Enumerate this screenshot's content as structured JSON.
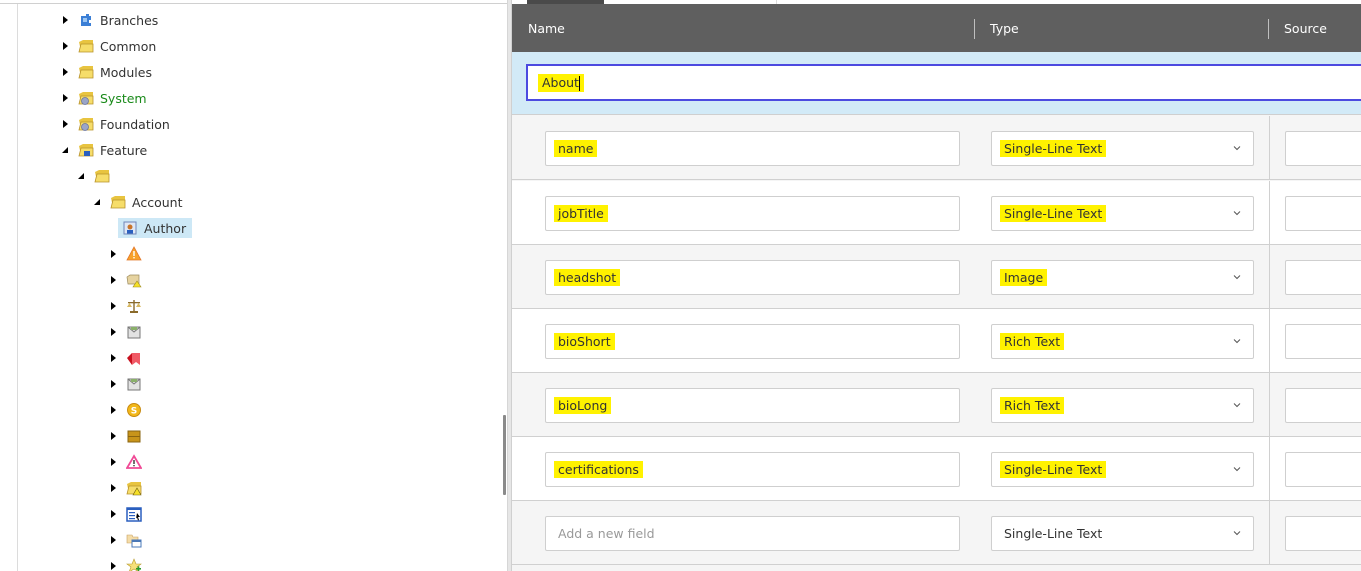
{
  "tree": {
    "nodes": [
      {
        "label": "Branches",
        "icon": "branches-icon",
        "expanded": false
      },
      {
        "label": "Common",
        "icon": "folder-icon",
        "expanded": false
      },
      {
        "label": "Modules",
        "icon": "folder-icon",
        "expanded": false
      },
      {
        "label": "System",
        "icon": "system-folder-icon",
        "expanded": false
      },
      {
        "label": "Foundation",
        "icon": "system-folder-icon",
        "expanded": false
      },
      {
        "label": "Feature",
        "icon": "feature-folder-icon",
        "expanded": true
      },
      {
        "label": "",
        "icon": "folder-icon",
        "expanded": true
      },
      {
        "label": "Account",
        "icon": "folder-icon",
        "expanded": true
      },
      {
        "label": "Author",
        "icon": "template-icon",
        "selected": true
      },
      {
        "label": "",
        "icon": "warning-icon",
        "expanded": false
      },
      {
        "label": "",
        "icon": "folder-warning-icon",
        "expanded": false
      },
      {
        "label": "",
        "icon": "scales-icon",
        "expanded": false
      },
      {
        "label": "",
        "icon": "envelope-icon",
        "expanded": false
      },
      {
        "label": "",
        "icon": "red-bookmark-icon",
        "expanded": false
      },
      {
        "label": "",
        "icon": "envelope-icon",
        "expanded": false
      },
      {
        "label": "",
        "icon": "coin-icon",
        "expanded": false
      },
      {
        "label": "",
        "icon": "drawer-icon",
        "expanded": false
      },
      {
        "label": "",
        "icon": "pink-warning-icon",
        "expanded": false
      },
      {
        "label": "",
        "icon": "folder-warning-icon",
        "expanded": false
      },
      {
        "label": "",
        "icon": "form-icon",
        "expanded": false
      },
      {
        "label": "",
        "icon": "folder-window-icon",
        "expanded": false
      },
      {
        "label": "",
        "icon": "star-add-icon",
        "expanded": false
      }
    ]
  },
  "editor": {
    "columns": {
      "name": "Name",
      "type": "Type",
      "source": "Source"
    },
    "section": {
      "name": "About"
    },
    "fields": [
      {
        "name": "name",
        "type": "Single-Line Text",
        "source": ""
      },
      {
        "name": "jobTitle",
        "type": "Single-Line Text",
        "source": ""
      },
      {
        "name": "headshot",
        "type": "Image",
        "source": ""
      },
      {
        "name": "bioShort",
        "type": "Rich Text",
        "source": ""
      },
      {
        "name": "bioLong",
        "type": "Rich Text",
        "source": ""
      },
      {
        "name": "certifications",
        "type": "Single-Line Text",
        "source": ""
      }
    ],
    "new_field": {
      "placeholder": "Add a new field",
      "type": "Single-Line Text"
    }
  }
}
